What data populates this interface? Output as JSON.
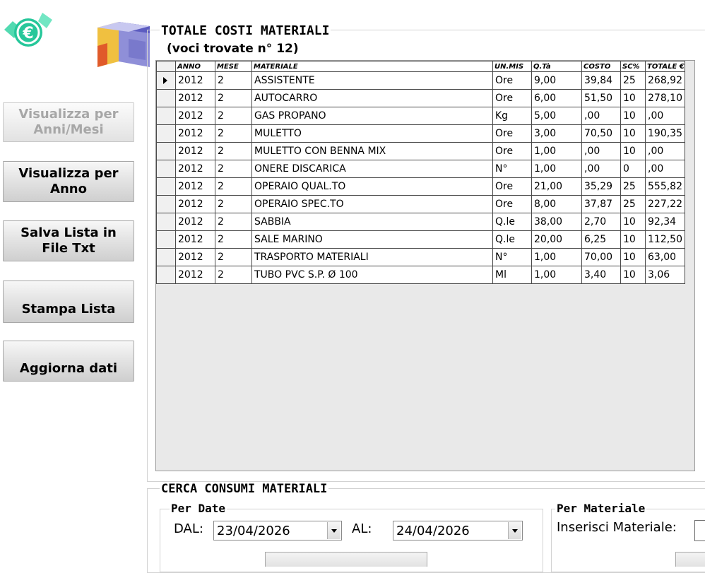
{
  "totale": {
    "title": "TOTALE COSTI MATERIALI",
    "subtitle": "(voci trovate n° 12)"
  },
  "sidebar": {
    "btn_anni_mesi": [
      "Visualizza per",
      "Anni/Mesi"
    ],
    "btn_anno": [
      "Visualizza per",
      "Anno"
    ],
    "btn_salva": [
      "Salva Lista in",
      "File Txt"
    ],
    "btn_stampa": "Stampa Lista",
    "btn_aggiorna": "Aggiorna dati"
  },
  "table": {
    "headers": [
      "ANNO",
      "MESE",
      "MATERIALE",
      "UN.MIS",
      "Q.Tà",
      "COSTO",
      "SC%",
      "TOTALE €"
    ],
    "rows": [
      [
        "2012",
        "2",
        "ASSISTENTE",
        "Ore",
        "9,00",
        "39,84",
        "25",
        "268,92"
      ],
      [
        "2012",
        "2",
        "AUTOCARRO",
        "Ore",
        "6,00",
        "51,50",
        "10",
        "278,10"
      ],
      [
        "2012",
        "2",
        "GAS PROPANO",
        "Kg",
        "5,00",
        ",00",
        "10",
        ",00"
      ],
      [
        "2012",
        "2",
        "MULETTO",
        "Ore",
        "3,00",
        "70,50",
        "10",
        "190,35"
      ],
      [
        "2012",
        "2",
        "MULETTO CON BENNA MIX",
        "Ore",
        "1,00",
        ",00",
        "10",
        ",00"
      ],
      [
        "2012",
        "2",
        "ONERE DISCARICA",
        "N°",
        "1,00",
        ",00",
        "0",
        ",00"
      ],
      [
        "2012",
        "2",
        "OPERAIO QUAL.TO",
        "Ore",
        "21,00",
        "35,29",
        "25",
        "555,82"
      ],
      [
        "2012",
        "2",
        "OPERAIO SPEC.TO",
        "Ore",
        "8,00",
        "37,87",
        "25",
        "227,22"
      ],
      [
        "2012",
        "2",
        "SABBIA",
        "Q.le",
        "38,00",
        "2,70",
        "10",
        "92,34"
      ],
      [
        "2012",
        "2",
        "SALE MARINO",
        "Q.le",
        "20,00",
        "6,25",
        "10",
        "112,50"
      ],
      [
        "2012",
        "2",
        "TRASPORTO MATERIALI",
        "N°",
        "1,00",
        "70,00",
        "10",
        "63,00"
      ],
      [
        "2012",
        "2",
        "TUBO PVC S.P. Ø 100",
        "Ml",
        "1,00",
        "3,40",
        "10",
        "3,06"
      ]
    ]
  },
  "cerca": {
    "title": "CERCA CONSUMI MATERIALI",
    "per_date": {
      "title": "Per Date",
      "dal_label": "DAL:",
      "dal_value": "23/04/2026",
      "al_label": "AL:",
      "al_value": "24/04/2026"
    },
    "per_materiale": {
      "title": "Per Materiale",
      "label": "Inserisci Materiale:",
      "value": ""
    }
  }
}
